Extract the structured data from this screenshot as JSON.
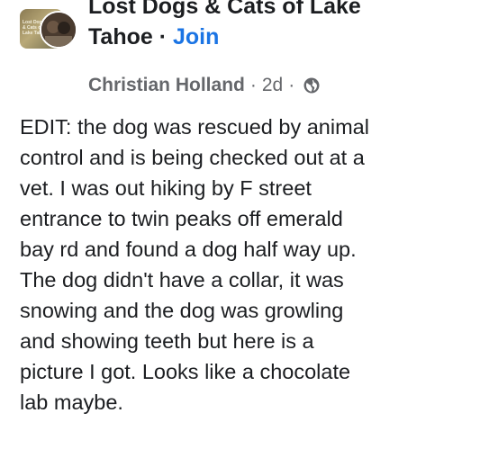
{
  "group": {
    "name_line1": "Lost Dogs & Cats of Lake",
    "name_line2": "Tahoe",
    "separator": "·",
    "join_label": "Join",
    "thumbnail_text": "Lost Dogs & Cats of Lake Tahoe"
  },
  "post": {
    "author": "Christian Holland",
    "separator": "·",
    "time": "2d",
    "separator2": "·",
    "privacy_icon": "globe-icon",
    "body_lines": [
      "EDIT: the dog was rescued by animal",
      "control and is being checked out at a",
      "vet. I was out hiking by F street",
      "entrance to twin peaks off emerald",
      "bay rd and found a dog half way up.",
      "The dog didn't have a collar, it was",
      "snowing and the dog was growling",
      "and showing teeth but here is a",
      "picture I got. Looks like a chocolate",
      "lab maybe."
    ]
  },
  "colors": {
    "link": "#1b74e4",
    "meta": "#65676b",
    "text": "#1c1e21"
  }
}
